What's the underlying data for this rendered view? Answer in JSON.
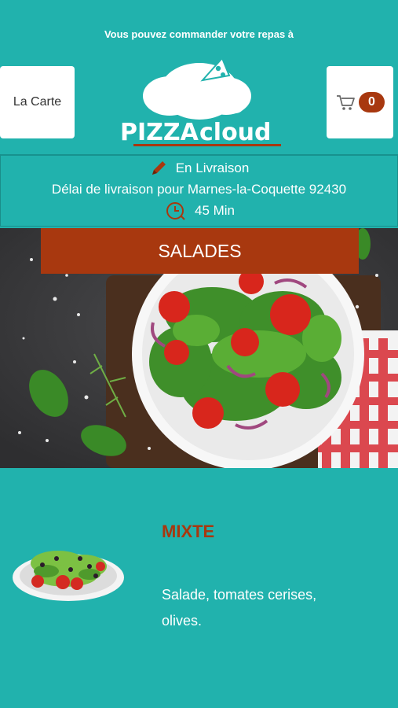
{
  "header": {
    "banner_text": "Vous pouvez commander votre repas à",
    "menu_label": "La Carte",
    "cart_count": "0",
    "logo_text": "PIZZA cloud"
  },
  "delivery": {
    "status": "En Livraison",
    "zone_text": "Délai de livraison pour Marnes-la-Coquette 92430",
    "time_text": "45 Min"
  },
  "section": {
    "title": "SALADES"
  },
  "products": [
    {
      "name": "MIXTE",
      "description": "Salade, tomates cerises, olives."
    }
  ],
  "colors": {
    "background": "#21b2ad",
    "accent": "#a8380f",
    "white": "#ffffff"
  }
}
